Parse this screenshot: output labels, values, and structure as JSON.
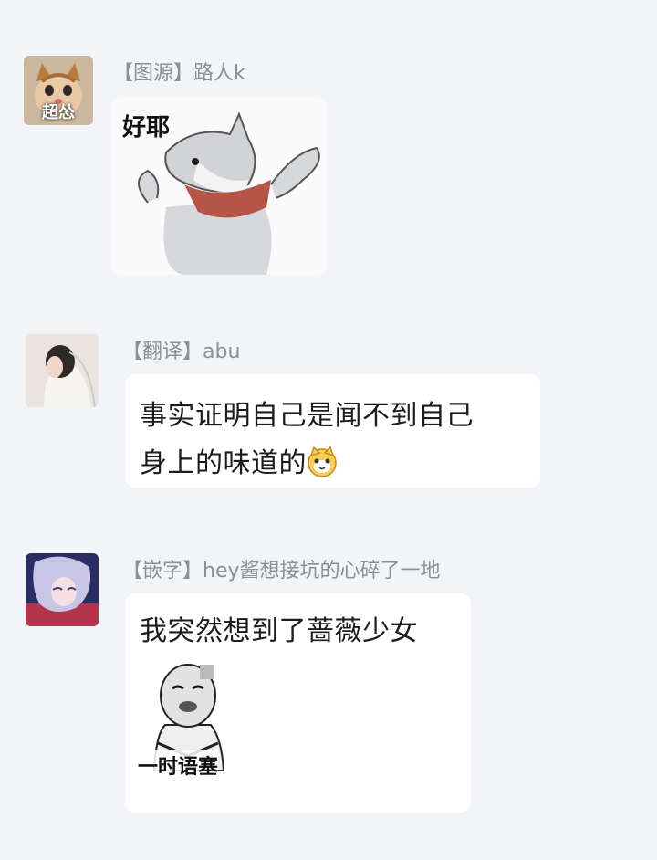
{
  "messages": [
    {
      "sender": "【图源】路人k",
      "avatar_caption": "超怂",
      "sticker_caption": "好耶",
      "type": "sticker"
    },
    {
      "sender": "【翻译】abu",
      "text_line1": "事实证明自己是闻不到自己",
      "text_line2": "身上的味道的",
      "emoji": "cat-face-icon",
      "type": "text"
    },
    {
      "sender": "【嵌字】hey酱想接坑的心碎了一地",
      "text": "我突然想到了蔷薇少女",
      "sticker_caption": "一时语塞",
      "type": "text+sticker"
    }
  ],
  "colors": {
    "background": "#f3f4f8",
    "bubble": "#ffffff",
    "name": "#8c8f99",
    "text": "#1c1c1e"
  }
}
